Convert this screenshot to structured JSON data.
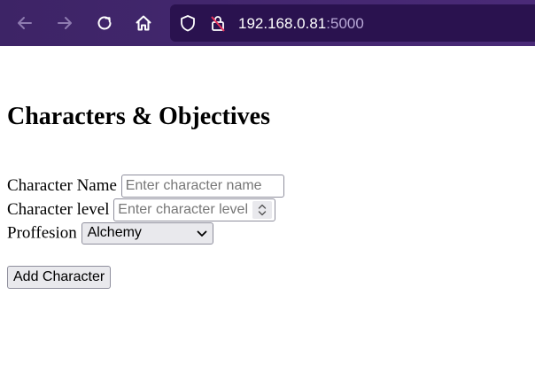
{
  "browser": {
    "url_host": "192.168.0.81",
    "url_port": ":5000",
    "icons": [
      "back-icon",
      "forward-icon",
      "reload-icon",
      "home-icon",
      "shield-icon",
      "insecure-lock-icon"
    ]
  },
  "page": {
    "title": "Characters & Objectives",
    "form": {
      "name_label": "Character Name",
      "name_placeholder": "Enter character name",
      "level_label": "Character level",
      "level_placeholder": "Enter character level",
      "profession_label": "Proffesion",
      "profession_selected": "Alchemy",
      "submit_label": "Add Character"
    }
  }
}
